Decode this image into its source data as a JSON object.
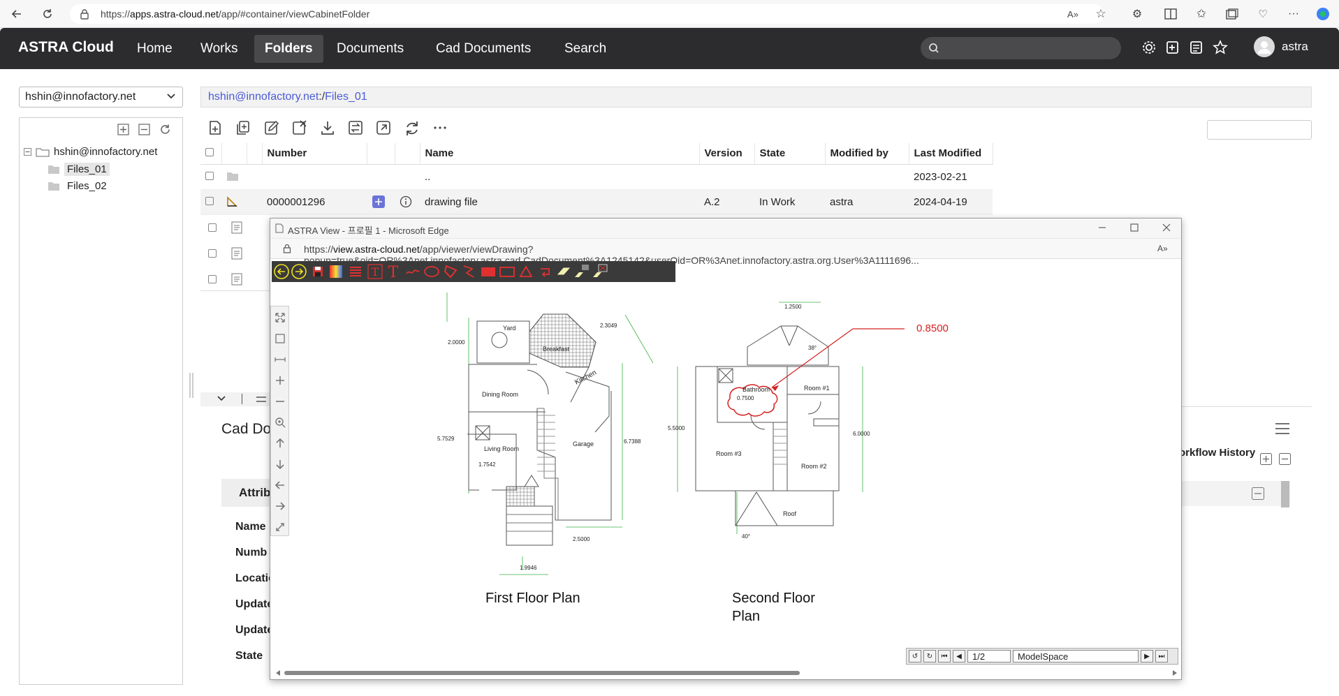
{
  "browser": {
    "url_prefix": "https://",
    "url_host": "apps.astra-cloud.net",
    "url_path": "/app/#container/viewCabinetFolder"
  },
  "nav": {
    "brand": "ASTRA Cloud",
    "items": [
      "Home",
      "Works",
      "Folders",
      "Documents",
      "Cad Documents",
      "Search"
    ],
    "active": "Folders",
    "user": "astra"
  },
  "left": {
    "owner_select": "hshin@innofactory.net",
    "tree_root": "hshin@innofactory.net",
    "tree_children": [
      "Files_01",
      "Files_02"
    ]
  },
  "main": {
    "breadcrumb_root": "hshin@innofactory.net",
    "breadcrumb_sep": ":/",
    "breadcrumb_folder": "Files_01",
    "columns": [
      "Number",
      "Name",
      "Version",
      "State",
      "Modified by",
      "Last Modified"
    ],
    "rows": [
      {
        "number": "",
        "name": "..",
        "version": "",
        "state": "",
        "modified_by": "",
        "last_modified": "2023-02-21"
      },
      {
        "number": "0000001296",
        "name": "drawing file",
        "version": "A.2",
        "state": "In Work",
        "modified_by": "astra",
        "last_modified": "2024-04-19"
      }
    ]
  },
  "detail": {
    "title": "Cad Do",
    "attributes_tab": "Attrib",
    "labels": [
      "Name",
      "Numb",
      "Locatio",
      "Update",
      "Update",
      "State"
    ],
    "workflow_tab": "orkflow History"
  },
  "popup": {
    "title": "ASTRA View - 프로필 1 - Microsoft Edge",
    "url_prefix": "https://",
    "url_host": "view.astra-cloud.net",
    "url_path": "/app/viewer/viewDrawing?popup=true&oid=OR%3Anet.innofactory.astra.cad.CadDocument%3A1245142&userOid=OR%3Anet.innofactory.astra.org.User%3A1111696...",
    "page_indicator": "1/2",
    "space": "ModelSpace"
  },
  "drawing": {
    "first_floor_title": "First Floor Plan",
    "second_floor_title_line1": "Second Floor",
    "second_floor_title_line2": "Plan",
    "first_floor": {
      "rooms": [
        "Yard",
        "Breakfast",
        "Kitchen",
        "Dining Room",
        "Living Room",
        "Garage"
      ],
      "dims": [
        "2.3049",
        "2.0000",
        "5.7529",
        "6.7388",
        "1.7542",
        "2.5000",
        "1.9946"
      ]
    },
    "second_floor": {
      "rooms": [
        "Bathroom",
        "Room #1",
        "Room #3",
        "Room #2",
        "Roof"
      ],
      "dims": [
        "1.2500",
        "38°",
        "0.7500",
        "5.5000",
        "6.0000",
        "40°"
      ]
    },
    "annotation_value": "0.8500",
    "annotation_color": "#d42020"
  }
}
